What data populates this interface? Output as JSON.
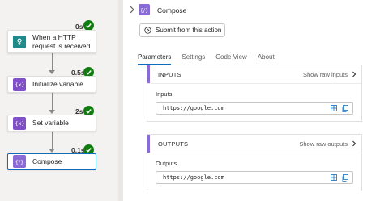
{
  "flow": {
    "steps": [
      {
        "label": "When a HTTP request is received",
        "duration": "0s",
        "icon": "http-trigger-icon",
        "color": "#1f8a8a"
      },
      {
        "label": "Initialize variable",
        "duration": "0.5s",
        "icon": "variable-icon",
        "color": "#8050c8"
      },
      {
        "label": "Set variable",
        "duration": "2s",
        "icon": "variable-icon",
        "color": "#8050c8"
      },
      {
        "label": "Compose",
        "duration": "0.1s",
        "icon": "compose-icon",
        "color": "#8a6bd6"
      }
    ],
    "status": "succeeded"
  },
  "panel": {
    "title": "Compose",
    "submit_label": "Submit from this action",
    "tabs": [
      {
        "label": "Parameters",
        "active": true
      },
      {
        "label": "Settings",
        "active": false
      },
      {
        "label": "Code View",
        "active": false
      },
      {
        "label": "About",
        "active": false
      }
    ],
    "inputs": {
      "header": "INPUTS",
      "raw_label": "Show raw inputs",
      "field_label": "Inputs",
      "value": "https://google.com"
    },
    "outputs": {
      "header": "OUTPUTS",
      "raw_label": "Show raw outputs",
      "field_label": "Outputs",
      "value": "https://google.com"
    }
  },
  "colors": {
    "accent": "#0f6cbd",
    "success": "#107c10",
    "compose": "#8a6bd6"
  }
}
